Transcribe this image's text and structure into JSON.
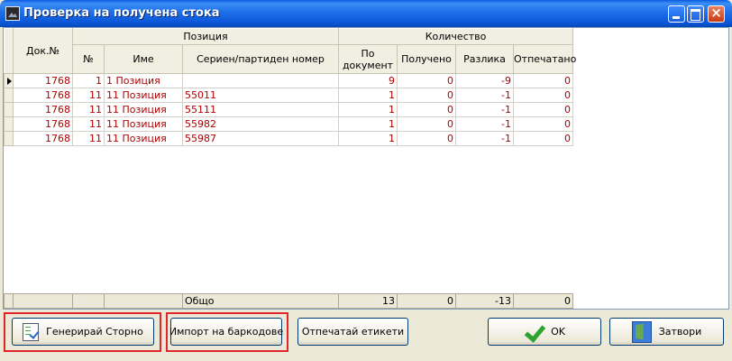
{
  "window": {
    "title": "Проверка на получена стока"
  },
  "grid": {
    "group_headers": {
      "doc": "Док.№",
      "position": "Позиция",
      "quantity": "Количество"
    },
    "columns": {
      "no": "№",
      "name": "Име",
      "serial": "Сериен/партиден номер",
      "by_doc_1": "По",
      "by_doc_2": "документ",
      "received": "Получено",
      "difference": "Разлика",
      "printed": "Отпечатано"
    },
    "rows": [
      {
        "doc": "1768",
        "no": "1",
        "name": "1 Позиция",
        "serial": "",
        "by_doc": "9",
        "received": "0",
        "difference": "-9",
        "printed": "0"
      },
      {
        "doc": "1768",
        "no": "11",
        "name": "11 Позиция",
        "serial": "55011",
        "by_doc": "1",
        "received": "0",
        "difference": "-1",
        "printed": "0"
      },
      {
        "doc": "1768",
        "no": "11",
        "name": "11 Позиция",
        "serial": "55111",
        "by_doc": "1",
        "received": "0",
        "difference": "-1",
        "printed": "0"
      },
      {
        "doc": "1768",
        "no": "11",
        "name": "11 Позиция",
        "serial": "55982",
        "by_doc": "1",
        "received": "0",
        "difference": "-1",
        "printed": "0"
      },
      {
        "doc": "1768",
        "no": "11",
        "name": "11 Позиция",
        "serial": "55987",
        "by_doc": "1",
        "received": "0",
        "difference": "-1",
        "printed": "0"
      }
    ],
    "footer": {
      "label": "Общо",
      "by_doc": "13",
      "received": "0",
      "difference": "-13",
      "printed": "0"
    }
  },
  "buttons": {
    "storno": "Генерирай Сторно",
    "import": "Импорт на баркодове",
    "print": "Отпечатай етикети",
    "ok": "OK",
    "close": "Затвори"
  },
  "icons": {
    "app": "stock-app-icon",
    "storno": "checklist-icon",
    "ok": "checkmark-icon",
    "close": "door-exit-icon"
  },
  "colors": {
    "titlebar": "#0a5ae0",
    "row_text": "#b00000",
    "highlight": "#e0262a"
  }
}
